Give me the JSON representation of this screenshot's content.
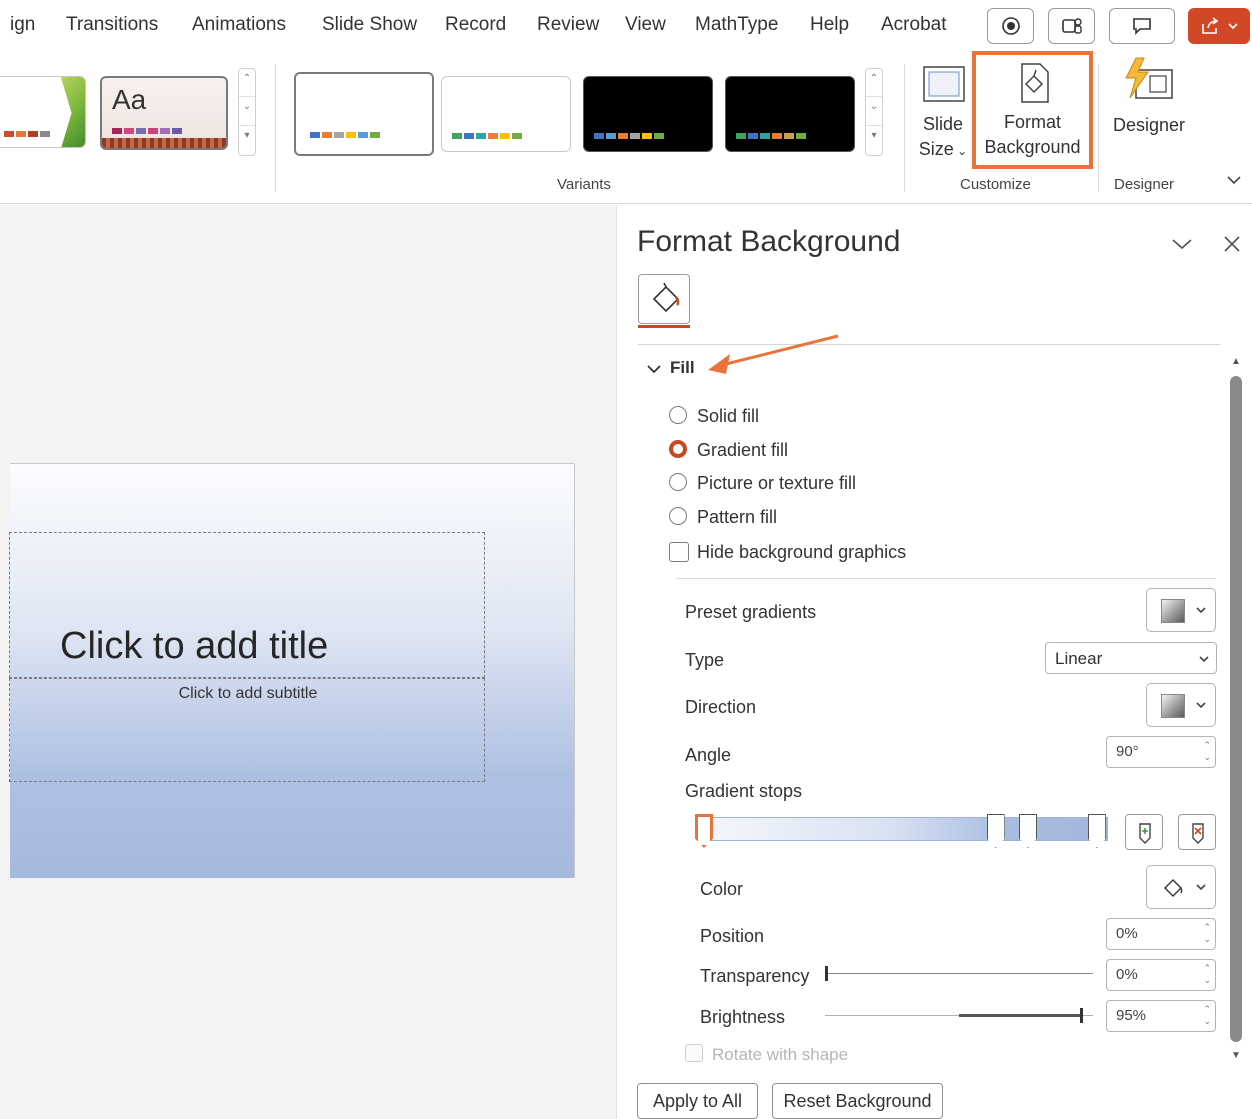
{
  "menu": {
    "tabs": [
      "ign",
      "Transitions",
      "Animations",
      "Slide Show",
      "Record",
      "Review",
      "View",
      "MathType",
      "Help",
      "Acrobat"
    ]
  },
  "ribbon": {
    "themes": {
      "selected_label": "Aa"
    },
    "variants": {
      "label": "Variants"
    },
    "customize": {
      "label": "Customize",
      "slide_size": {
        "line1": "Slide",
        "line2": "Size"
      },
      "format_background": {
        "line1": "Format",
        "line2": "Background"
      }
    },
    "designer": {
      "label": "Designer",
      "button": "Designer"
    }
  },
  "slide": {
    "title": "Click to add title",
    "subtitle": "Click to add subtitle"
  },
  "pane": {
    "title": "Format Background",
    "fill": {
      "section_label": "Fill",
      "options": [
        {
          "label": "Solid fill",
          "selected": false
        },
        {
          "label": "Gradient fill",
          "selected": true
        },
        {
          "label": "Picture or texture fill",
          "selected": false
        },
        {
          "label": "Pattern fill",
          "selected": false
        }
      ],
      "hide_graphics": {
        "label": "Hide background graphics",
        "checked": false
      },
      "preset_gradients": "Preset gradients",
      "type": {
        "label": "Type",
        "value": "Linear"
      },
      "direction": "Direction",
      "angle": {
        "label": "Angle",
        "value": "90°"
      },
      "gradient_stops": "Gradient stops",
      "stop_positions": [
        0,
        0.72,
        0.8,
        0.97
      ],
      "color": "Color",
      "position": {
        "label": "Position",
        "value": "0%"
      },
      "transparency": {
        "label": "Transparency",
        "value": "0%",
        "level": 0
      },
      "brightness": {
        "label": "Brightness",
        "value": "95%",
        "level": 0.95
      },
      "rotate": "Rotate with shape"
    },
    "buttons": {
      "apply_all": "Apply to All",
      "reset": "Reset Background"
    }
  },
  "colors": {
    "accent": "#e8743b",
    "pane_accent": "#c8491f",
    "share": "#d24726"
  }
}
